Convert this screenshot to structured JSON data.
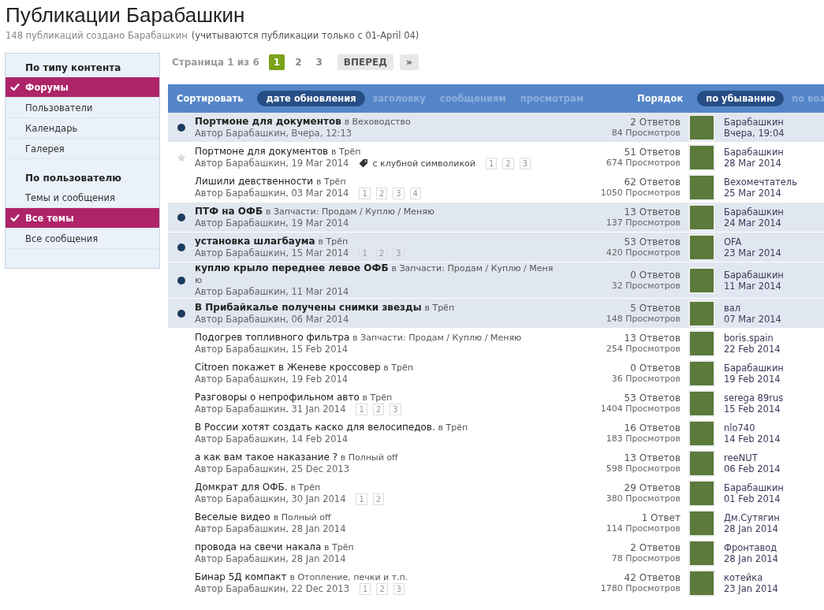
{
  "header": {
    "title": "Публикации Барабашкин",
    "subtitle": "148 публикаций создано Барабашкин",
    "note": "(учитываются публикации только с 01-April 04)"
  },
  "sidebar": [
    {
      "heading": "По типу контента",
      "items": [
        {
          "label": "Форумы",
          "selected": true
        },
        {
          "label": "Пользователи",
          "selected": false
        },
        {
          "label": "Календарь",
          "selected": false
        },
        {
          "label": "Галерея",
          "selected": false
        }
      ]
    },
    {
      "heading": "По пользователю",
      "items": [
        {
          "label": "Темы и сообщения",
          "selected": false
        },
        {
          "label": "Все темы",
          "selected": true
        },
        {
          "label": "Все сообщения",
          "selected": false
        }
      ]
    }
  ],
  "pagination": {
    "label": "Страница 1 из 6",
    "pages": [
      {
        "label": "1",
        "selected": true
      },
      {
        "label": "2",
        "selected": false
      },
      {
        "label": "3",
        "selected": false
      }
    ],
    "next": "ВПЕРЕД",
    "last": "»"
  },
  "sort_bar": {
    "sort_label": "Сортировать",
    "sort_options": [
      {
        "label": "дате обновления",
        "selected": true
      },
      {
        "label": "заголовку",
        "selected": false
      },
      {
        "label": "сообщениям",
        "selected": false
      },
      {
        "label": "просмотрам",
        "selected": false
      }
    ],
    "order_label": "Порядок",
    "order_options": [
      {
        "label": "по убыванию",
        "selected": true
      },
      {
        "label": "по воз",
        "selected": false
      }
    ]
  },
  "topics": [
    {
      "title": "Портмоне для документов",
      "forum": "в Веховодство",
      "byline": "Автор Барабашкин, Вчера, 12:13",
      "unread": true,
      "starred": false,
      "replies": "2 Ответов",
      "views": "84 Просмотров",
      "last_user": "Барабашкин",
      "last_date": "Вчера, 19:04"
    },
    {
      "title": "Портмоне для документов",
      "forum": "в Трёп",
      "byline": "Автор Барабашкин, 19 Mar 2014",
      "tag": "с клубной символикой",
      "unread": false,
      "starred": true,
      "pages": [
        "1",
        "2",
        "3"
      ],
      "replies": "51 Ответов",
      "views": "674 Просмотров",
      "last_user": "Барабашкин",
      "last_date": "28 Mar 2014"
    },
    {
      "title": "Лишили девственности",
      "forum": "в Трёп",
      "byline": "Автор Барабашкин, 03 Mar 2014",
      "unread": false,
      "starred": false,
      "pages": [
        "1",
        "2",
        "3",
        "4"
      ],
      "replies": "62 Ответов",
      "views": "1050 Просмотров",
      "last_user": "Вехомечтатель",
      "last_date": "25 Mar 2014"
    },
    {
      "title": "ПТФ на ОФБ",
      "forum": "в Запчасти: Продам / Куплю / Меняю",
      "byline": "Автор Барабашкин, 19 Mar 2014",
      "unread": true,
      "starred": false,
      "replies": "13 Ответов",
      "views": "137 Просмотров",
      "last_user": "Барабашкин",
      "last_date": "24 Mar 2014"
    },
    {
      "title": "установка шлагбаума",
      "forum": "в Трёп",
      "byline": "Автор Барабашкин, 15 Mar 2014",
      "unread": true,
      "starred": false,
      "pages": [
        "1",
        "2",
        "3"
      ],
      "replies": "53 Ответов",
      "views": "420 Просмотров",
      "last_user": "OFA",
      "last_date": "23 Mar 2014"
    },
    {
      "title": "куплю крыло переднее левое ОФБ",
      "forum": "в Запчасти: Продам / Куплю / Меняю",
      "byline": "Автор Барабашкин, 11 Mar 2014",
      "unread": true,
      "starred": false,
      "replies": "0 Ответов",
      "views": "32 Просмотров",
      "last_user": "Барабашкин",
      "last_date": "11 Mar 2014"
    },
    {
      "title": "В Прибайкалье получены снимки звезды",
      "forum": "в Трёп",
      "byline": "Автор Барабашкин, 06 Mar 2014",
      "unread": true,
      "starred": false,
      "replies": "5 Ответов",
      "views": "148 Просмотров",
      "last_user": "вал",
      "last_date": "07 Mar 2014"
    },
    {
      "title": "Подогрев топливного фильтра",
      "forum": "в Запчасти: Продам / Куплю / Меняю",
      "byline": "Автор Барабашкин, 15 Feb 2014",
      "unread": false,
      "starred": false,
      "replies": "13 Ответов",
      "views": "254 Просмотров",
      "last_user": "boris.spain",
      "last_date": "22 Feb 2014"
    },
    {
      "title": "Citroen покажет в Женеве кроссовер",
      "forum": "в Трёп",
      "byline": "Автор Барабашкин, 19 Feb 2014",
      "unread": false,
      "starred": false,
      "replies": "0 Ответов",
      "views": "36 Просмотров",
      "last_user": "Барабашкин",
      "last_date": "19 Feb 2014"
    },
    {
      "title": "Разговоры о непрофильном авто",
      "forum": "в Трёп",
      "byline": "Автор Барабашкин, 31 Jan 2014",
      "unread": false,
      "starred": false,
      "pages": [
        "1",
        "2",
        "3"
      ],
      "replies": "53 Ответов",
      "views": "1404 Просмотров",
      "last_user": "serega 89rus",
      "last_date": "15 Feb 2014"
    },
    {
      "title": "В России хотят создать каско для велосипедов.",
      "forum": "в Трёп",
      "byline": "Автор Барабашкин, 14 Feb 2014",
      "unread": false,
      "starred": false,
      "replies": "16 Ответов",
      "views": "183 Просмотров",
      "last_user": "nlo740",
      "last_date": "14 Feb 2014"
    },
    {
      "title": "а как вам такое наказание ?",
      "forum": "в Полный off",
      "byline": "Автор Барабашкин, 25 Dec 2013",
      "unread": false,
      "starred": false,
      "replies": "13 Ответов",
      "views": "598 Просмотров",
      "last_user": "reeNUT",
      "last_date": "06 Feb 2014"
    },
    {
      "title": "Домкрат для ОФБ.",
      "forum": "в Трёп",
      "byline": "Автор Барабашкин, 30 Jan 2014",
      "unread": false,
      "starred": false,
      "pages": [
        "1",
        "2"
      ],
      "replies": "29 Ответов",
      "views": "380 Просмотров",
      "last_user": "Барабашкин",
      "last_date": "01 Feb 2014"
    },
    {
      "title": "Веселые видео",
      "forum": "в Полный off",
      "byline": "Автор Барабашкин, 28 Jan 2014",
      "unread": false,
      "starred": false,
      "replies": "1 Ответ",
      "views": "114 Просмотров",
      "last_user": "Дм.Сутягин",
      "last_date": "28 Jan 2014"
    },
    {
      "title": "провода на свечи накала",
      "forum": "в Трёп",
      "byline": "Автор Барабашкин, 28 Jan 2014",
      "unread": false,
      "starred": false,
      "replies": "2 Ответов",
      "views": "78 Просмотров",
      "last_user": "Фронтавод",
      "last_date": "28 Jan 2014"
    },
    {
      "title": "Бинар 5Д компакт",
      "forum": "в Отопление, печки и т.п.",
      "byline": "Автор Барабашкин, 22 Dec 2013",
      "unread": false,
      "starred": false,
      "pages": [
        "1",
        "2",
        "3"
      ],
      "replies": "42 Ответов",
      "views": "1780 Просмотров",
      "last_user": "котейка",
      "last_date": "23 Jan 2014"
    }
  ]
}
